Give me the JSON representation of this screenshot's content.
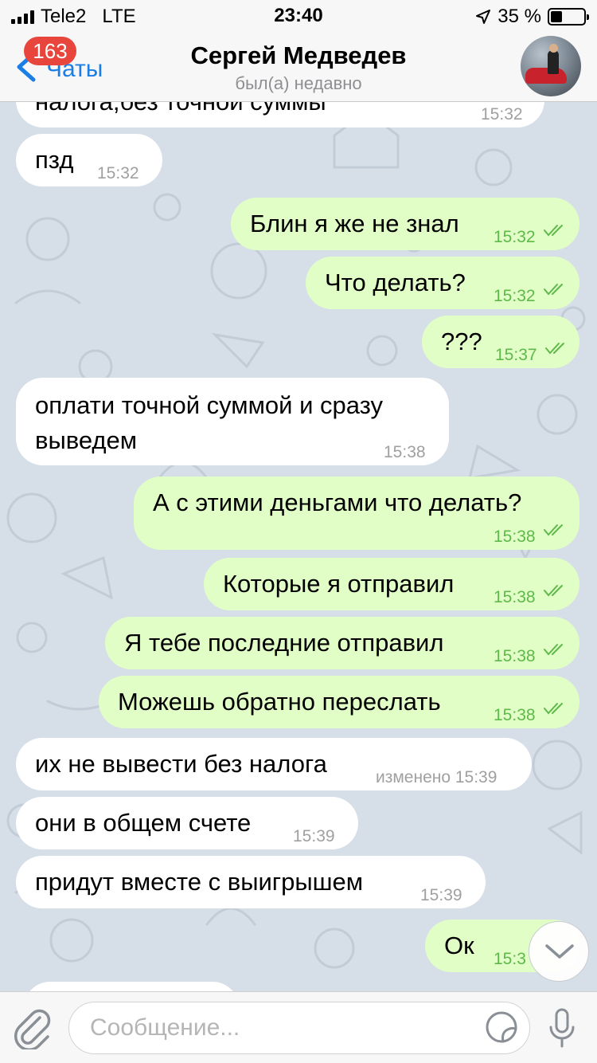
{
  "status_bar": {
    "carrier": "Tele2",
    "network": "LTE",
    "time": "23:40",
    "battery_percent": "35 %",
    "battery_level": 0.35
  },
  "header": {
    "back_label": "Чаты",
    "unread_count": "163",
    "title": "Сергей Медведев",
    "subtitle": "был(а) недавно"
  },
  "messages": [
    {
      "dir": "in",
      "text": "налога,без точной суммы",
      "time": "15:32"
    },
    {
      "dir": "in",
      "text": "пзд",
      "time": "15:32"
    },
    {
      "dir": "out",
      "text": "Блин я же не знал",
      "time": "15:32"
    },
    {
      "dir": "out",
      "text": "Что делать?",
      "time": "15:32"
    },
    {
      "dir": "out",
      "text": "???",
      "time": "15:37"
    },
    {
      "dir": "in",
      "text": "оплати точной суммой и сразу выведем",
      "time": "15:38"
    },
    {
      "dir": "out",
      "text": "А с этими деньгами что делать?",
      "time": "15:38"
    },
    {
      "dir": "out",
      "text": "Которые я отправил",
      "time": "15:38"
    },
    {
      "dir": "out",
      "text": "Я тебе последние отправил",
      "time": "15:38"
    },
    {
      "dir": "out",
      "text": "Можешь обратно переслать",
      "time": "15:38"
    },
    {
      "dir": "in",
      "text": "их не вывести без налога",
      "time": "изменено 15:39"
    },
    {
      "dir": "in",
      "text": "они в общем счете",
      "time": "15:39"
    },
    {
      "dir": "in",
      "text": "придут вместе с выигрышем",
      "time": "15:39"
    },
    {
      "dir": "out",
      "text": "Ок",
      "time": "15:3"
    }
  ],
  "input": {
    "placeholder": "Сообщение..."
  },
  "colors": {
    "accent": "#1a7ee6",
    "badge": "#e8453c",
    "outgoing_bubble": "#e1fec6",
    "incoming_bubble": "#ffffff",
    "read_check": "#5fb94a"
  },
  "icons": {
    "back": "chevron-left-icon",
    "read": "double-check-icon",
    "scroll": "chevron-down-icon",
    "attach": "paperclip-icon",
    "sticker": "sticker-icon",
    "voice": "microphone-icon",
    "location": "location-arrow-icon"
  }
}
